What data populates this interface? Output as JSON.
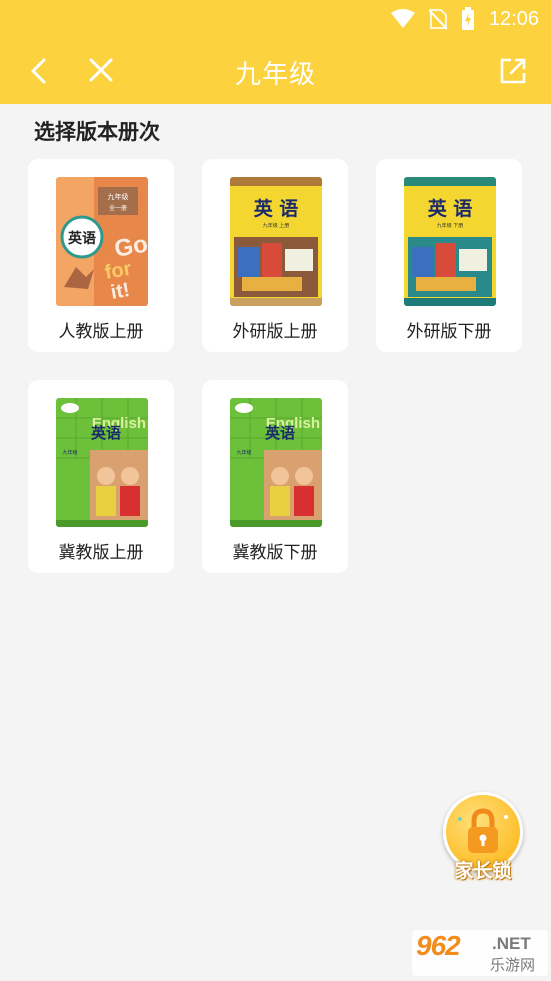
{
  "status_bar": {
    "time": "12:06"
  },
  "header": {
    "title": "九年级",
    "back_icon": "chevron-left-icon",
    "close_icon": "close-icon",
    "share_icon": "share-icon",
    "bg_color": "#fdd23f"
  },
  "section": {
    "title": "选择版本册次"
  },
  "books": [
    {
      "label": "人教版上册",
      "cover_title": "英语",
      "cover_grade": "九年级",
      "cover_vol": "全一册"
    },
    {
      "label": "外研版上册",
      "cover_title": "英 语",
      "cover_grade": "九年级 上册"
    },
    {
      "label": "外研版下册",
      "cover_title": "英 语",
      "cover_grade": "九年级 下册"
    },
    {
      "label": "冀教版上册",
      "cover_title": "英语",
      "cover_en": "English",
      "cover_grade": "九年级"
    },
    {
      "label": "冀教版下册",
      "cover_title": "英语",
      "cover_en": "English",
      "cover_grade": "九年级"
    }
  ],
  "parent_lock": {
    "label": "家长锁",
    "icon": "lock-icon"
  },
  "watermark": {
    "number": "962",
    "net": ".NET",
    "sub": "乐游网"
  }
}
